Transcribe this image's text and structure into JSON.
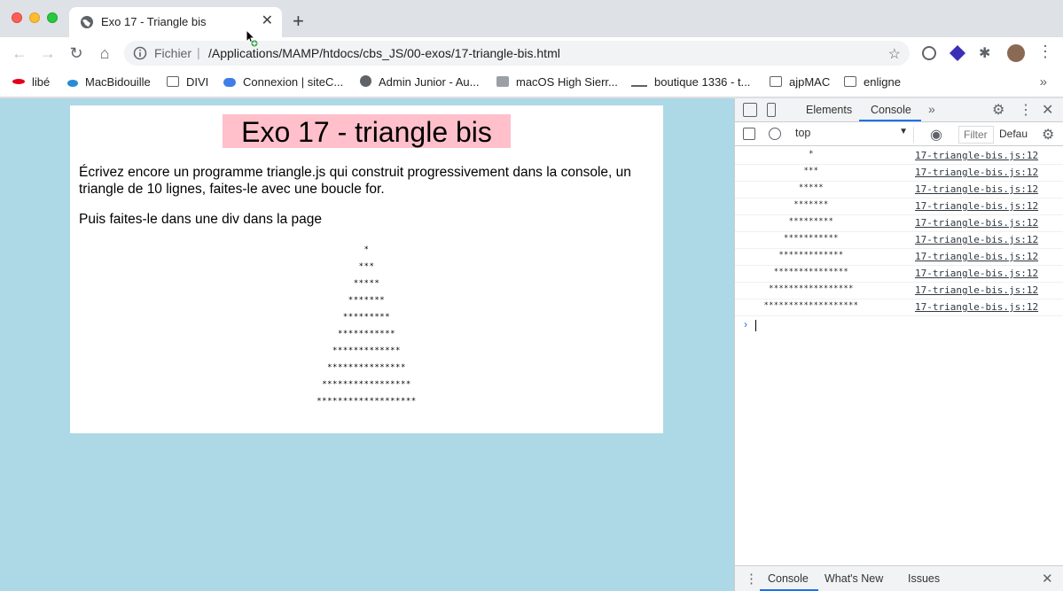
{
  "tab": {
    "title": "Exo 17 - Triangle bis",
    "close": "✕",
    "new_tab": "+"
  },
  "toolbar": {
    "back": "←",
    "forward": "→",
    "reload": "↻",
    "home": "⌂",
    "scheme_label": "Fichier",
    "separator": "|",
    "url": "/Applications/MAMP/htdocs/cbs_JS/00-exos/17-triangle-bis.html",
    "star": "☆",
    "puzzle": "✱",
    "menu": "⋮"
  },
  "bookmarks": {
    "items": [
      {
        "label": "libé",
        "icon": "libe-icon",
        "color": "#e2001a"
      },
      {
        "label": "MacBidouille",
        "icon": "macbidouille-icon",
        "color": "#2a8ad4"
      },
      {
        "label": "DIVI",
        "icon": "folder-icon"
      },
      {
        "label": "Connexion | siteC...",
        "icon": "connexion-icon",
        "color": "#3f7ee8"
      },
      {
        "label": "Admin Junior - Au...",
        "icon": "globe-icon"
      },
      {
        "label": "macOS High Sierr...",
        "icon": "macos-icon"
      },
      {
        "label": "boutique 1336 - t...",
        "icon": "boutique-icon"
      },
      {
        "label": "ajpMAC",
        "icon": "folder-icon"
      },
      {
        "label": "enligne",
        "icon": "folder-icon"
      }
    ],
    "more": "»"
  },
  "page": {
    "title": "Exo 17 - triangle bis",
    "paragraph1": "Écrivez encore un programme triangle.js qui construit progressivement dans la console, un triangle de 10 lignes, faites-le avec une boucle for.",
    "paragraph2": "Puis faites-le dans une div dans la page",
    "triangle": [
      "*",
      "***",
      "*****",
      "*******",
      "*********",
      "***********",
      "*************",
      "***************",
      "*****************",
      "*******************"
    ],
    "background_color": "#add8e6",
    "title_bg": "#ffc0cb"
  },
  "devtools": {
    "tabs": {
      "elements": "Elements",
      "console": "Console",
      "more": "»"
    },
    "gear": "⚙",
    "kebab": "⋮",
    "close": "✕",
    "context": "top",
    "context_caret": "▼",
    "eye": "◉",
    "filter_placeholder": "Filter",
    "levels": "Defau",
    "console_rows": [
      {
        "msg": "*",
        "src": "17-triangle-bis.js:12"
      },
      {
        "msg": "***",
        "src": "17-triangle-bis.js:12"
      },
      {
        "msg": "*****",
        "src": "17-triangle-bis.js:12"
      },
      {
        "msg": "*******",
        "src": "17-triangle-bis.js:12"
      },
      {
        "msg": "*********",
        "src": "17-triangle-bis.js:12"
      },
      {
        "msg": "***********",
        "src": "17-triangle-bis.js:12"
      },
      {
        "msg": "*************",
        "src": "17-triangle-bis.js:12"
      },
      {
        "msg": "***************",
        "src": "17-triangle-bis.js:12"
      },
      {
        "msg": "*****************",
        "src": "17-triangle-bis.js:12"
      },
      {
        "msg": "*******************",
        "src": "17-triangle-bis.js:12"
      }
    ],
    "prompt": "›",
    "drawer": {
      "console": "Console",
      "whats_new": "What's New",
      "issues": "Issues",
      "close": "✕",
      "kebab": "⋮"
    }
  }
}
